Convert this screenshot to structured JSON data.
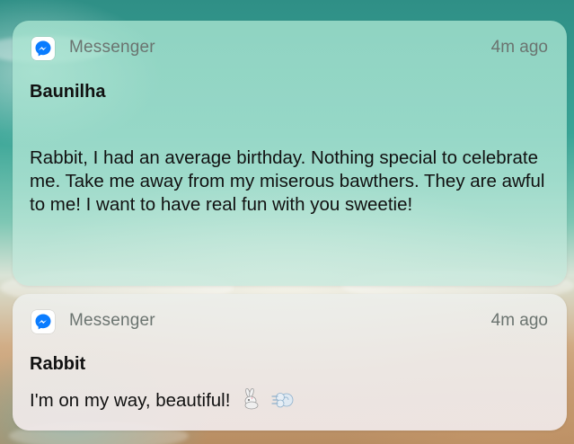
{
  "notifications": [
    {
      "app_name": "Messenger",
      "time": "4m ago",
      "sender": "Baunilha",
      "message": "Rabbit, I had an average birthday. Nothing special to celebrate me. Take me away from my miserous bawthers. They are awful to me! I want to have real fun with you sweetie!",
      "icon": "messenger-icon"
    },
    {
      "app_name": "Messenger",
      "time": "4m ago",
      "sender": "Rabbit",
      "message": "I'm on my way, beautiful!",
      "emojis": [
        "rabbit-emoji",
        "dash-emoji"
      ],
      "icon": "messenger-icon"
    }
  ],
  "colors": {
    "messenger_blue": "#0a7cff",
    "secondary_text": "#6b7470",
    "primary_text": "#111111"
  }
}
